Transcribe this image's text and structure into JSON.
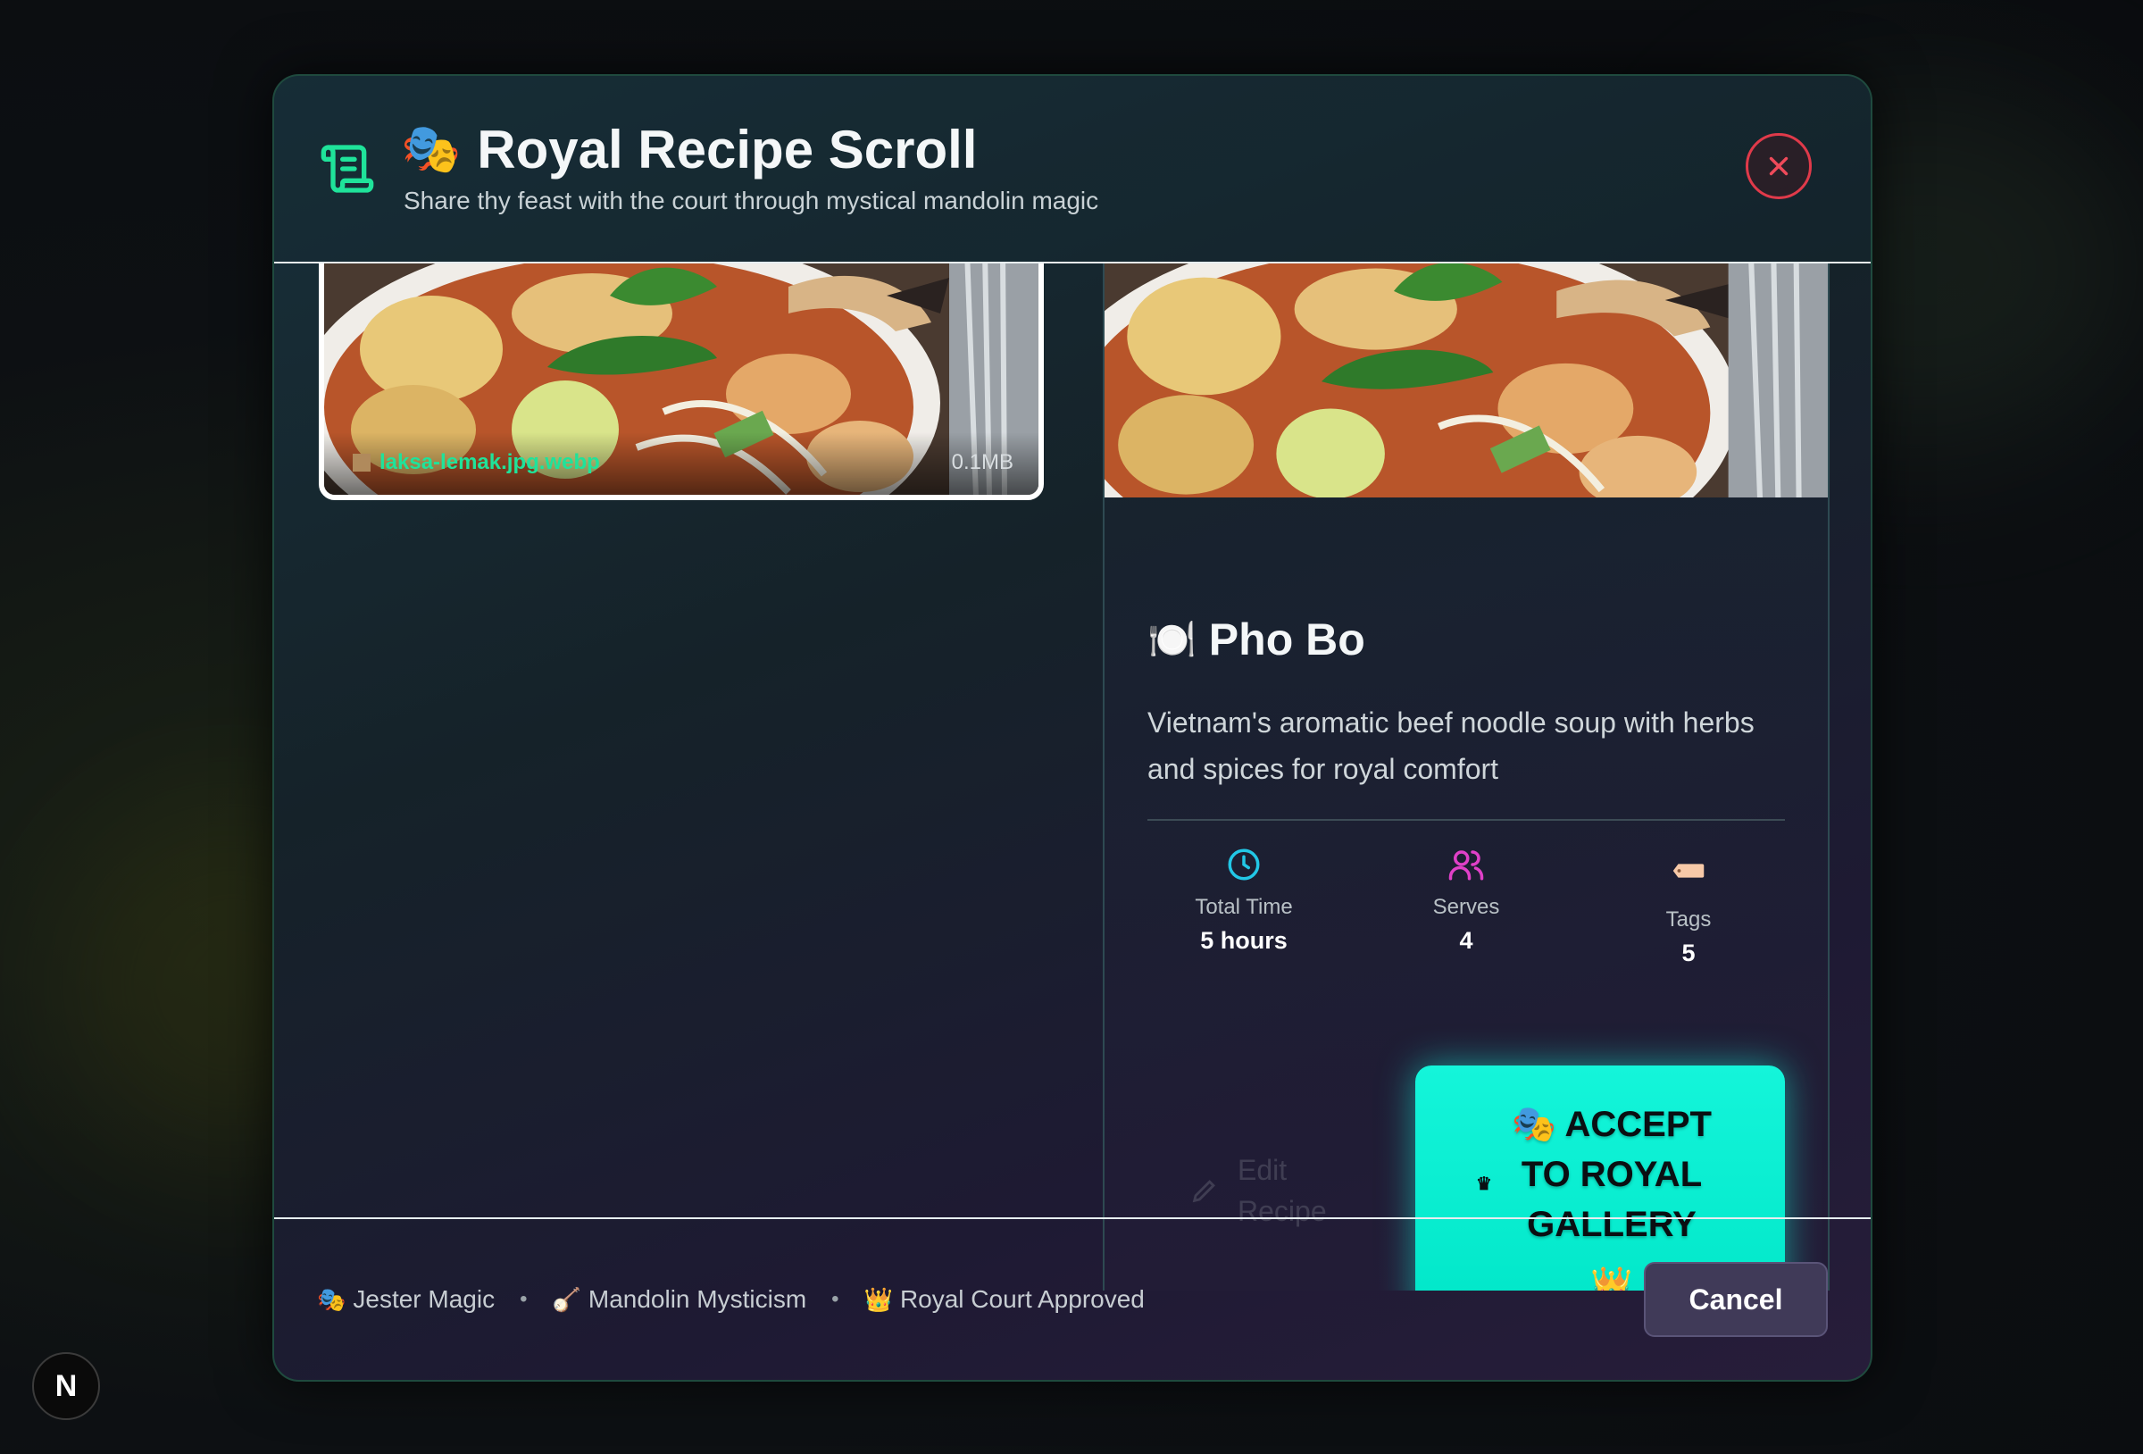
{
  "modal": {
    "title_emoji": "🎭",
    "title": "Royal Recipe Scroll",
    "subtitle": "Share thy feast with the court through mystical mandolin magic",
    "close_icon": "close-icon"
  },
  "upload": {
    "file_name": "laksa-lemak.jpg.webp",
    "file_size": "0.1MB"
  },
  "recipe": {
    "emoji": "🍽️",
    "name": "Pho Bo",
    "description": "Vietnam's aromatic beef noodle soup with herbs and spices for royal comfort",
    "stats": [
      {
        "icon": "clock-icon",
        "label": "Total Time",
        "value": "5 hours",
        "color": "#22c7e6"
      },
      {
        "icon": "users-icon",
        "label": "Serves",
        "value": "4",
        "color": "#e040c8"
      },
      {
        "icon": "tag-icon",
        "label": "Tags",
        "value": "5",
        "color": "#f7c9a8"
      }
    ],
    "edit_label": "Edit Recipe",
    "accept_label": "🎭 ACCEPT TO ROYAL GALLERY",
    "accept_crown": "👑",
    "accept_crown_small": "♛"
  },
  "footer": {
    "badges": [
      {
        "emoji": "🎭",
        "label": "Jester Magic"
      },
      {
        "emoji": "🪕",
        "label": "Mandolin Mysticism"
      },
      {
        "emoji": "👑",
        "label": "Royal Court Approved"
      }
    ],
    "separator": "•",
    "cancel_label": "Cancel"
  },
  "nextjs_badge": "N",
  "colors": {
    "accent_green": "#1fe39a",
    "accept_cyan": "#14f5da",
    "close_red": "#e03a4a"
  }
}
